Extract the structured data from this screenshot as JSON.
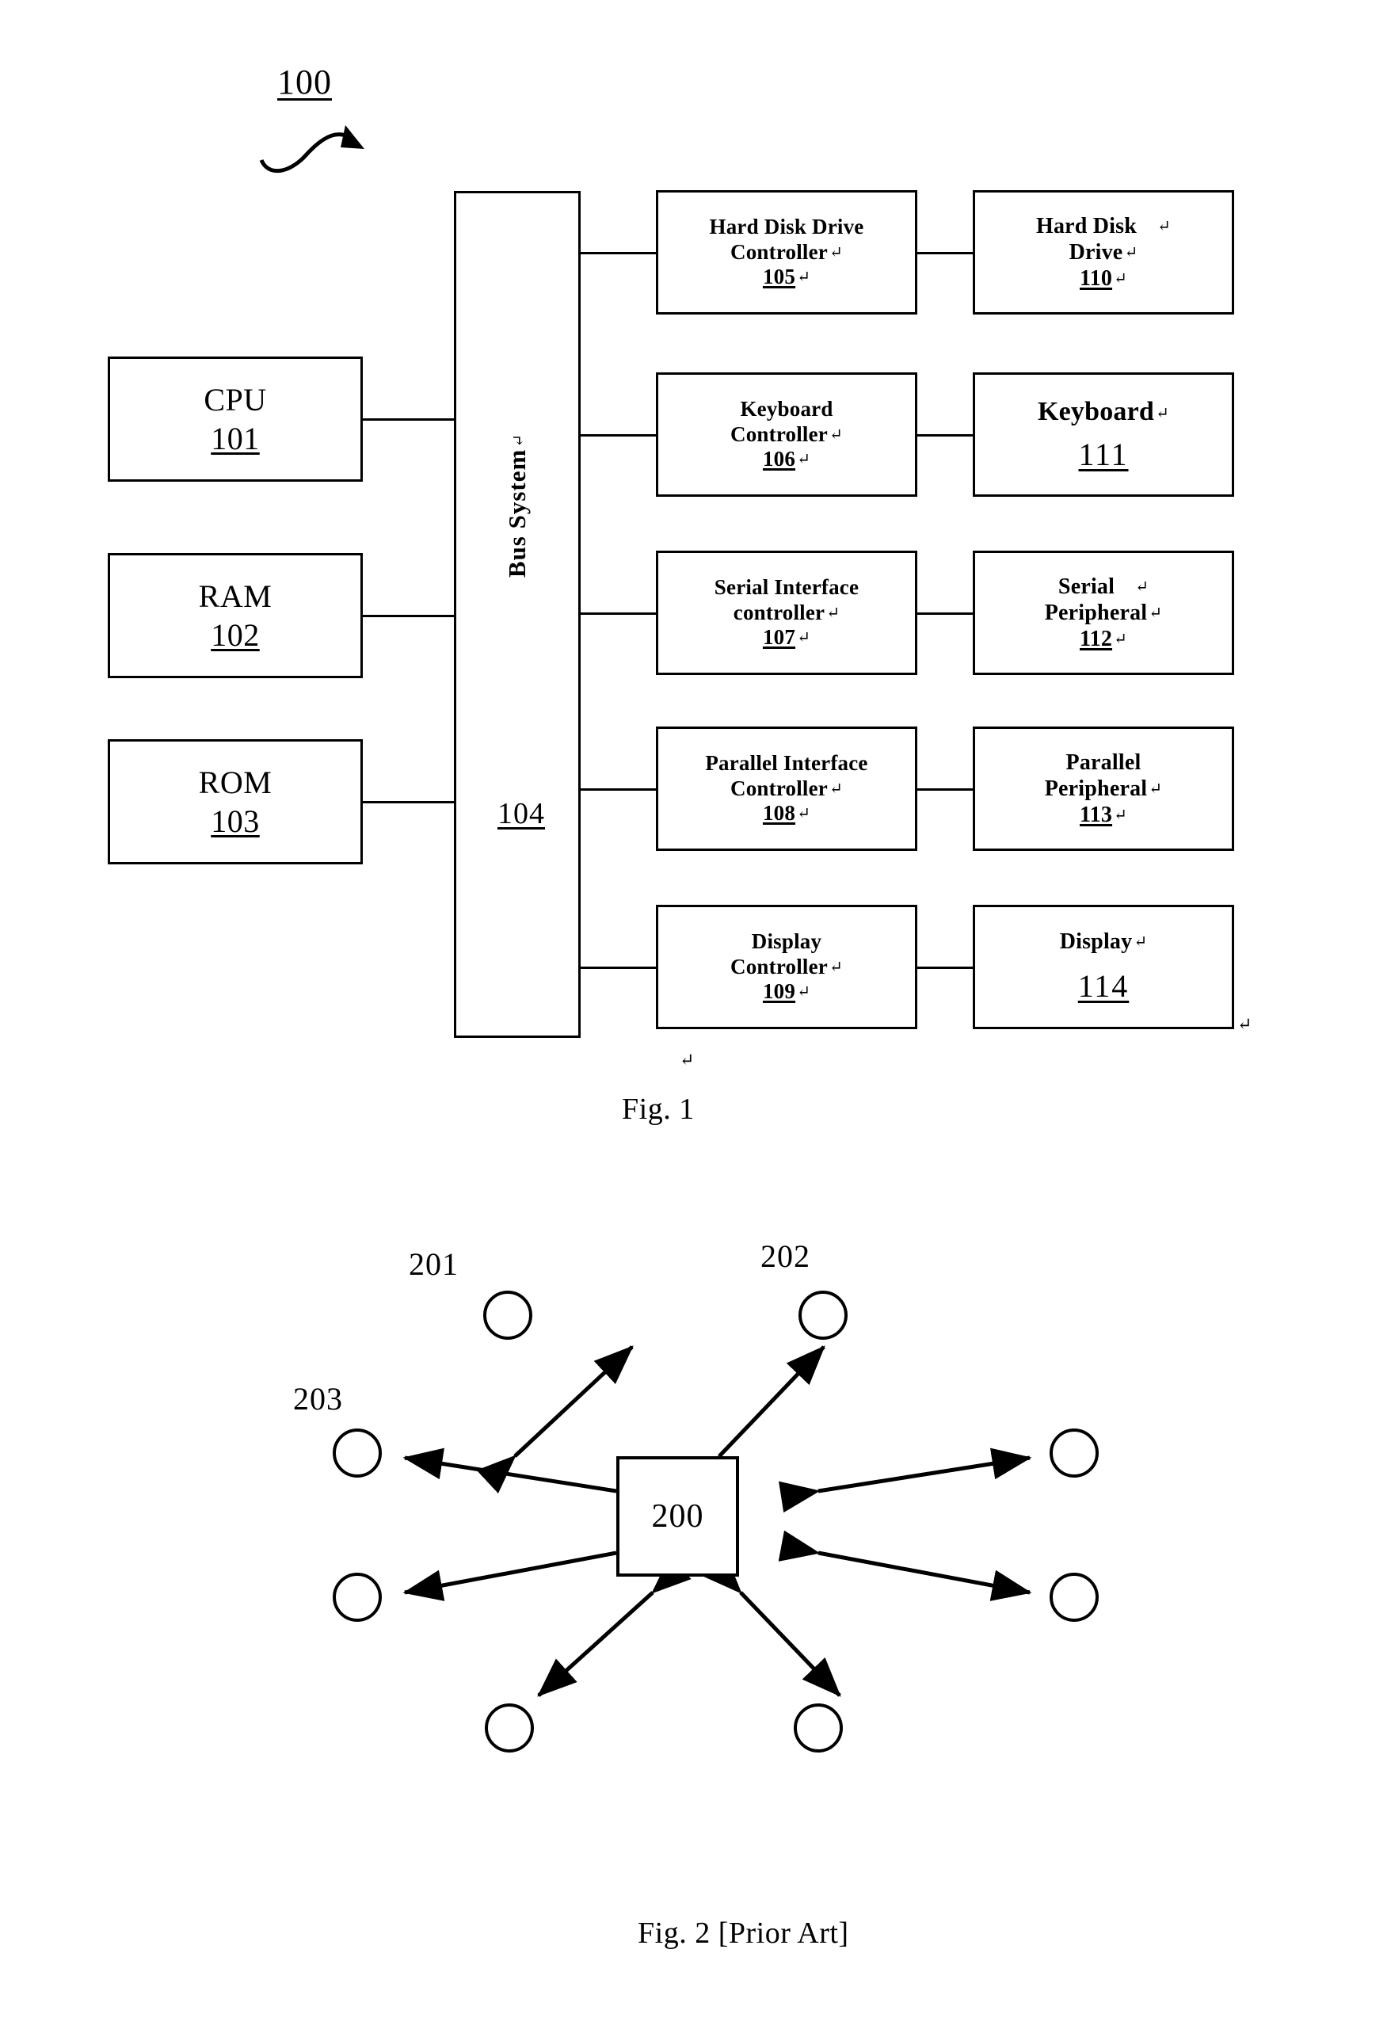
{
  "figure1": {
    "marker": "100",
    "caption": "Fig. 1",
    "memory": [
      {
        "name": "CPU",
        "ref": "101"
      },
      {
        "name": "RAM",
        "ref": "102"
      },
      {
        "name": "ROM",
        "ref": "103"
      }
    ],
    "bus": {
      "label": "Bus System",
      "cr": "↵",
      "ref": "104"
    },
    "controllers": [
      {
        "line1": "Hard Disk Drive",
        "line2": "Controller",
        "ref": "105",
        "cr": "↵"
      },
      {
        "line1": "Keyboard",
        "line2": "Controller",
        "ref": "106",
        "cr": "↵"
      },
      {
        "line1": "Serial Interface",
        "line2": "controller",
        "ref": "107",
        "cr": "↵"
      },
      {
        "line1": "Parallel Interface",
        "line2": "Controller",
        "ref": "108",
        "cr": "↵"
      },
      {
        "line1": "Display",
        "line2": "Controller",
        "ref": "109",
        "cr": "↵"
      }
    ],
    "peripherals": [
      {
        "line1": "Hard Disk",
        "line2": "Drive",
        "ref": "110",
        "cr": "↵",
        "big": false
      },
      {
        "line1": "Keyboard",
        "line2": "",
        "ref": "111",
        "cr": "↵",
        "big": true
      },
      {
        "line1": "Serial",
        "line2": "Peripheral",
        "ref": "112",
        "cr": "↵",
        "big": false
      },
      {
        "line1": "Parallel",
        "line2": "Peripheral",
        "ref": "113",
        "cr": "↵",
        "big": false
      },
      {
        "line1": "Display",
        "line2": "",
        "ref": "114",
        "cr": "↵",
        "big": true
      }
    ],
    "stray_marks": [
      "↵",
      "↵"
    ]
  },
  "figure2": {
    "caption": "Fig. 2 [Prior Art]",
    "center": {
      "ref": "200"
    },
    "labels": [
      {
        "ref": "201"
      },
      {
        "ref": "202"
      },
      {
        "ref": "203"
      }
    ],
    "node_count": 8
  }
}
